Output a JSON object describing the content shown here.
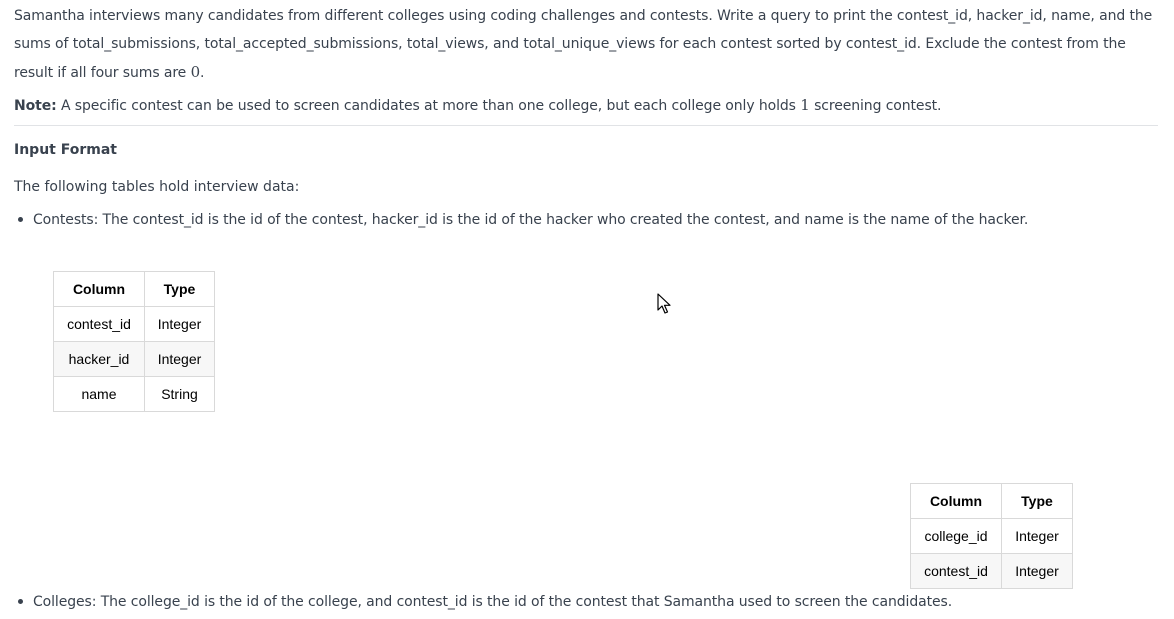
{
  "problem": {
    "paragraph_1": "Samantha interviews many candidates from different colleges using coding challenges and contests. Write a query to print the contest_id, hacker_id, name, and the sums of total_submissions, total_accepted_submissions, total_views, and total_unique_views for each contest sorted by contest_id. Exclude the contest from the result if all four sums are",
    "paragraph_1_zero": "0",
    "paragraph_1_end": ".",
    "note_label": "Note:",
    "note_text": "A specific contest can be used to screen candidates at more than one college, but each college only holds",
    "note_number": "1",
    "note_end": "screening contest.",
    "input_format_heading": "Input Format",
    "tables_intro": "The following tables hold interview data:",
    "contests_bullet": "Contests: The contest_id is the id of the contest, hacker_id is the id of the hacker who created the contest, and name is the name of the hacker.",
    "colleges_bullet": "Colleges: The college_id is the id of the college, and contest_id is the id of the contest that Samantha used to screen the candidates."
  },
  "contests_table": {
    "headers": [
      "Column",
      "Type"
    ],
    "rows": [
      [
        "contest_id",
        "Integer"
      ],
      [
        "hacker_id",
        "Integer"
      ],
      [
        "name",
        "String"
      ]
    ]
  },
  "colleges_table": {
    "headers": [
      "Column",
      "Type"
    ],
    "rows": [
      [
        "college_id",
        "Integer"
      ],
      [
        "contest_id",
        "Integer"
      ]
    ]
  },
  "icons": {
    "cursor": "mouse-pointer-icon"
  }
}
